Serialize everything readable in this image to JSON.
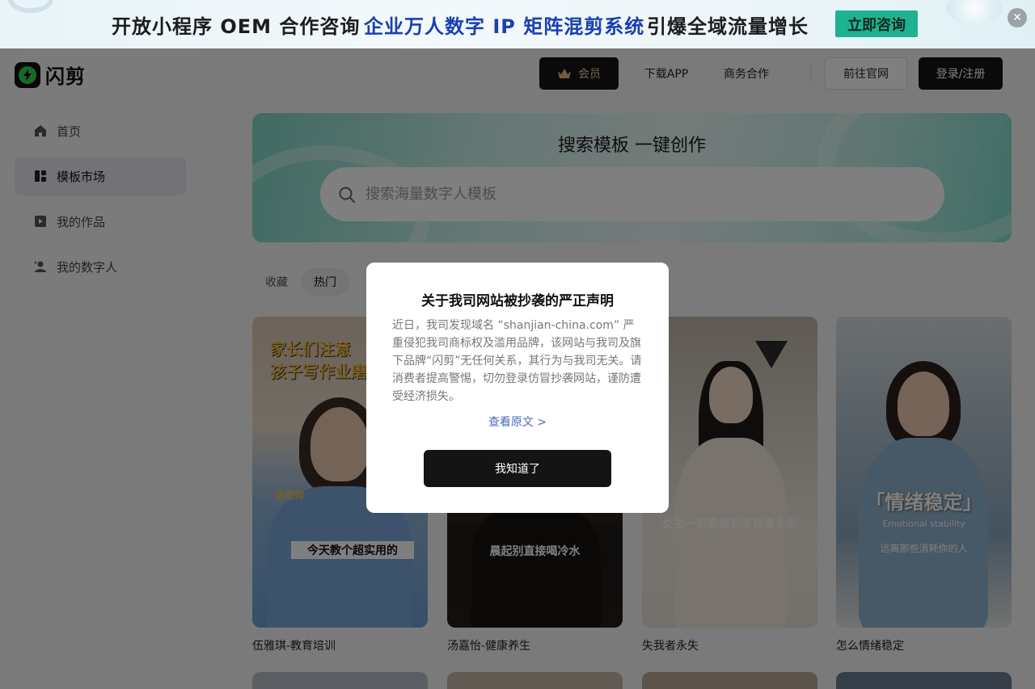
{
  "banner": {
    "text1": "开放小程序 OEM 合作咨询",
    "text2": "企业万人数字 IP 矩阵混剪系统",
    "text3": "引爆全域流量增长",
    "cta": "立即咨询",
    "close": "✕"
  },
  "brand": {
    "name": "闪剪",
    "icon": "lightning-bolt-icon",
    "accent": "#35d04a"
  },
  "sidebar": {
    "items": [
      {
        "label": "首页",
        "icon": "home-icon",
        "active": false
      },
      {
        "label": "模板市场",
        "icon": "template-grid-icon",
        "active": true
      },
      {
        "label": "我的作品",
        "icon": "play-video-icon",
        "active": false
      },
      {
        "label": "我的数字人",
        "icon": "user-avatar-icon",
        "active": false
      }
    ]
  },
  "header": {
    "vip": "会员",
    "download": "下载APP",
    "business": "商务合作",
    "official_site": "前往官网",
    "login": "登录/注册"
  },
  "hero": {
    "title": "搜索模板 一键创作",
    "search_placeholder": "搜索海量数字人模板",
    "search_value": ""
  },
  "tabs": [
    {
      "label": "收藏",
      "active": false
    },
    {
      "label": "热门",
      "active": true
    }
  ],
  "cards": [
    {
      "caption": "伍雅琪-教育培训",
      "headline1": "家长们注意",
      "headline2": "孩子写作业磨蹭",
      "tag": "伍老师",
      "subtitle": "今天教个超实用的"
    },
    {
      "caption": "汤嘉怡-健康养生",
      "subtitle": "晨起别直接喝冷水"
    },
    {
      "caption": "失我者永失",
      "subtitle": "女生一定要做到失我者永失"
    },
    {
      "caption": "怎么情绪稳定",
      "big": "「情绪稳定」",
      "en": "Emotional stability",
      "subtitle": "远离那些消耗你的人"
    }
  ],
  "modal": {
    "title": "关于我司网站被抄袭的严正声明",
    "body": "近日，我司发现域名 “shanjian-china.com” 严重侵犯我司商标权及滥用品牌，该网站与我司及旗下品牌“闪剪”无任何关系，其行为与我司无关。请消费者提高警惕，切勿登录仿冒抄袭网站，谨防遭受经济损失。",
    "link": "查看原文 >",
    "confirm": "我知道了"
  }
}
